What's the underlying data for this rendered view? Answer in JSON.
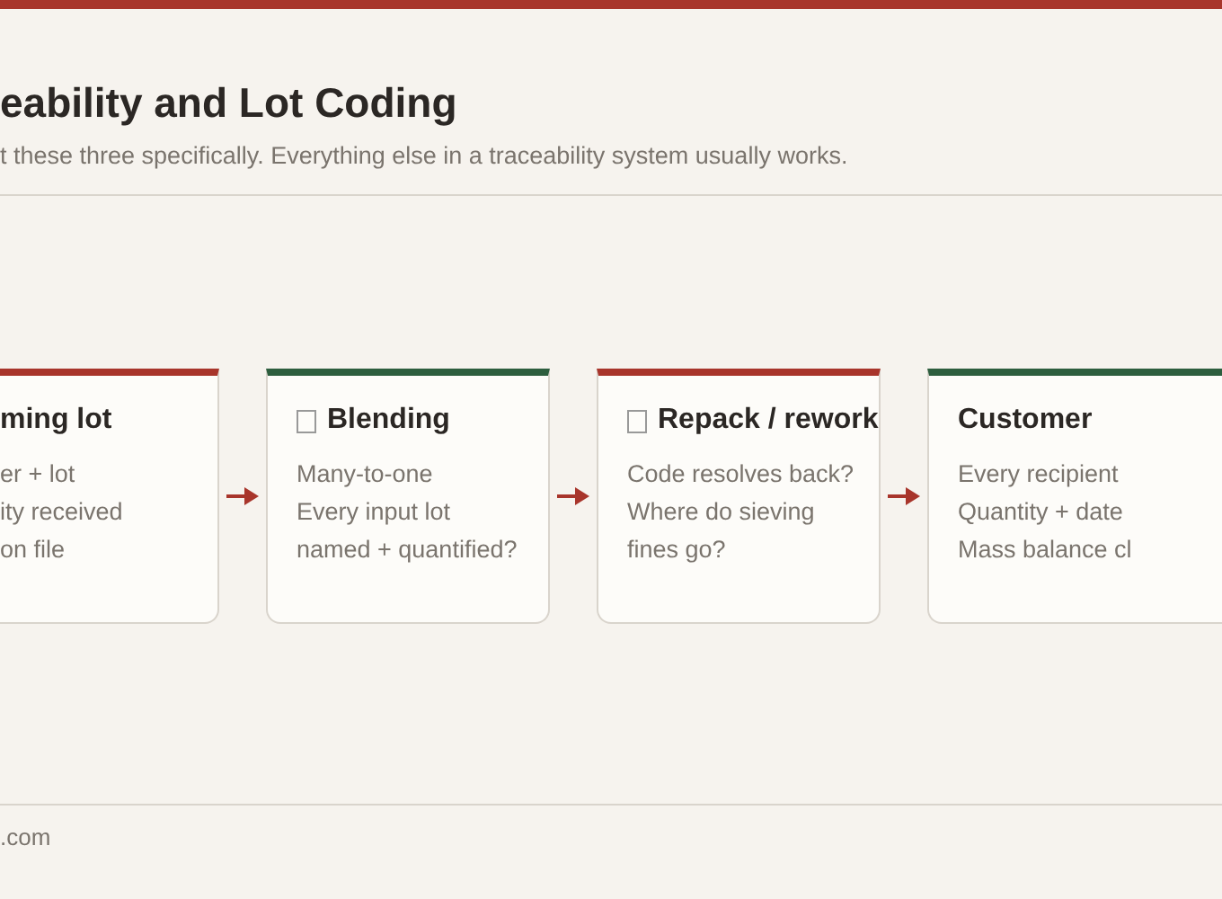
{
  "header": {
    "title": "eability and Lot Coding",
    "subtitle": "t these three specifically. Everything else in a traceability system usually works."
  },
  "cards": [
    {
      "kind": "plain",
      "title": "ming lot",
      "color": "#a8352b",
      "lines": [
        "er + lot",
        "ity received",
        "on file"
      ]
    },
    {
      "kind": "with-icon",
      "title": "Blending",
      "color": "#2d5e3e",
      "lines": [
        "Many-to-one",
        "Every input lot",
        "named + quantified?"
      ]
    },
    {
      "kind": "with-icon",
      "title": "Repack / rework",
      "color": "#a8352b",
      "lines": [
        "Code resolves back?",
        "Where do sieving",
        "fines go?"
      ]
    },
    {
      "kind": "plain",
      "title": "Customer",
      "color": "#2d5e3e",
      "lines": [
        "Every recipient",
        "Quantity + date",
        "Mass balance cl"
      ]
    }
  ],
  "footer": {
    "text": ".com"
  }
}
